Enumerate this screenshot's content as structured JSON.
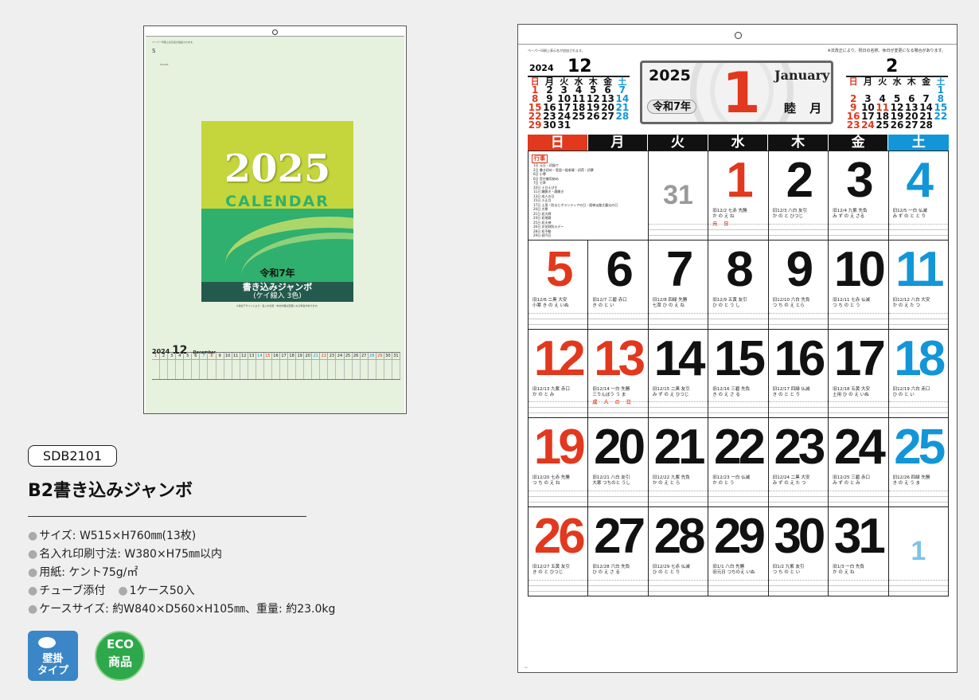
{
  "cover": {
    "top_note": "ペーパー印刷上表示名が追加されます。",
    "logo": "S",
    "small_code": "SA-001",
    "year": "2025",
    "word": "CALENDAR",
    "era": "令和7年",
    "band_title": "書き込みジャンボ",
    "band_sub": "(ケイ線入 3色)",
    "note": "※当社デザインにより、名入れ位置・本文内容は変更になる場合があります。",
    "strip_year": "2024",
    "strip_month": "12",
    "strip_en": "December",
    "strip_days": [
      "1",
      "2",
      "3",
      "4",
      "5",
      "6",
      "7",
      "8",
      "9",
      "10",
      "11",
      "12",
      "13",
      "14",
      "15",
      "16",
      "17",
      "18",
      "19",
      "20",
      "21",
      "22",
      "23",
      "24",
      "25",
      "26",
      "27",
      "28",
      "29",
      "30",
      "31"
    ]
  },
  "spec": {
    "code": "SDB2101",
    "title": "B2書き込みジャンボ",
    "rows": [
      "サイズ: W515×H760㎜(13枚)",
      "名入れ印刷寸法: W380×H75㎜以内",
      "用紙: ケント75g/㎡"
    ],
    "row4_a": "チューブ添付",
    "row4_b": "1ケース50入",
    "row5": "ケースサイズ: 約W840×D560×H105㎜、重量: 約23.0kg",
    "bullet": "●"
  },
  "badges": {
    "wall": "壁掛タイプ",
    "wall_l1": "壁掛",
    "wall_l2": "タイプ",
    "eco_l1": "ECO",
    "eco_l2": "商品"
  },
  "sheet": {
    "note_left": "ペーパー印刷上表示名が追加されます。",
    "note_right": "※法改正により、祝日の名称、休日が変更になる場合があります。",
    "footer": "ee",
    "prev_year": "2024",
    "prev_month": "12",
    "next_month": "2",
    "header": {
      "year": "2025",
      "month": "1",
      "english": "January",
      "era": "令和7年",
      "traditional": "睦 月"
    },
    "weekdays": [
      "日",
      "月",
      "火",
      "水",
      "木",
      "金",
      "土"
    ],
    "mini_prev": [
      "日",
      "月",
      "火",
      "水",
      "木",
      "金",
      "土",
      "1",
      "2",
      "3",
      "4",
      "5",
      "6",
      "7",
      "8",
      "9",
      "10",
      "11",
      "12",
      "13",
      "14",
      "15",
      "16",
      "17",
      "18",
      "19",
      "20",
      "21",
      "22",
      "23",
      "24",
      "25",
      "26",
      "27",
      "28",
      "29",
      "30",
      "31",
      "",
      "",
      "",
      ""
    ],
    "mini_next": [
      "日",
      "月",
      "火",
      "水",
      "木",
      "金",
      "土",
      "",
      "",
      "",
      "",
      "",
      "",
      "1",
      "2",
      "3",
      "4",
      "5",
      "6",
      "7",
      "8",
      "9",
      "10",
      "11",
      "12",
      "13",
      "14",
      "15",
      "16",
      "17",
      "18",
      "19",
      "20",
      "21",
      "22",
      "23",
      "24",
      "25",
      "26",
      "27",
      "28",
      "",
      ""
    ],
    "events_title": "行事",
    "events": [
      "1日 元旦・初詣で",
      "2日 書き初め・皇居一般参賀・初荷・初夢",
      "6日 小寒",
      "6日 官庁御用始め",
      "7日 七草",
      "10日 十日えびす",
      "11日 鏡開き・蔵開き",
      "13日 成人の日",
      "15日 小正月",
      "17日 土用・防災とボランティアの日・阪神淡路大震災の日",
      "20日 大寒",
      "21日 初大師",
      "24日 初地蔵",
      "25日 初天神",
      "26日 文化財防火デー",
      "28日 初不動",
      "29日 初円日"
    ],
    "cells": [
      {
        "n": "",
        "c": "",
        "i1": "",
        "i2": "",
        "h": ""
      },
      {
        "n": "",
        "c": "",
        "i1": "",
        "i2": "",
        "h": ""
      },
      {
        "n": "31",
        "c": "g",
        "i1": "",
        "i2": "",
        "h": ""
      },
      {
        "n": "1",
        "c": "r",
        "i1": "旧12/2 七赤 先勝",
        "i2": "か の え ね",
        "h": "元 日"
      },
      {
        "n": "2",
        "c": "",
        "i1": "旧12/3 八白 友引",
        "i2": "か の と ひつじ",
        "h": ""
      },
      {
        "n": "3",
        "c": "",
        "i1": "旧12/4 九紫 先負",
        "i2": "み ず の え さる",
        "h": ""
      },
      {
        "n": "4",
        "c": "b",
        "i1": "旧12/5 一白 仏滅",
        "i2": "み ず の と と り",
        "h": ""
      },
      {
        "n": "5",
        "c": "r",
        "i1": "旧12/6 二黒 大安",
        "i2": "小寒 き の え いぬ",
        "h": ""
      },
      {
        "n": "6",
        "c": "",
        "i1": "旧12/7 三碧 赤口",
        "i2": "き の と い",
        "h": ""
      },
      {
        "n": "7",
        "c": "",
        "i1": "旧12/8 四緑 先勝",
        "i2": "七草 ひ の え ね",
        "h": ""
      },
      {
        "n": "8",
        "c": "",
        "i1": "旧12/9 五黄 友引",
        "i2": "ひ の と う し",
        "h": ""
      },
      {
        "n": "9",
        "c": "",
        "i1": "旧12/10 六白 先負",
        "i2": "つ ち の え とら",
        "h": ""
      },
      {
        "n": "10",
        "c": "",
        "i1": "旧12/11 七赤 仏滅",
        "i2": "つ ち の と う",
        "h": ""
      },
      {
        "n": "11",
        "c": "b",
        "i1": "旧12/12 八白 大安",
        "i2": "か の え た つ",
        "h": ""
      },
      {
        "n": "12",
        "c": "r",
        "i1": "旧12/13 九紫 赤口",
        "i2": "か の と み",
        "h": ""
      },
      {
        "n": "13",
        "c": "r",
        "i1": "旧12/14 一白 先勝",
        "i2": "三りんぼう う ま",
        "h": "成 人 の 日"
      },
      {
        "n": "14",
        "c": "",
        "i1": "旧12/15 二黒 友引",
        "i2": "み ず の え ひつじ",
        "h": ""
      },
      {
        "n": "15",
        "c": "",
        "i1": "旧12/16 三碧 先負",
        "i2": "き の え さ る",
        "h": ""
      },
      {
        "n": "16",
        "c": "",
        "i1": "旧12/17 四緑 仏滅",
        "i2": "き の と と り",
        "h": ""
      },
      {
        "n": "17",
        "c": "",
        "i1": "旧12/18 五黄 大安",
        "i2": "土用 ひ の え いぬ",
        "h": ""
      },
      {
        "n": "18",
        "c": "b",
        "i1": "旧12/19 六白 赤口",
        "i2": "ひ の と い",
        "h": ""
      },
      {
        "n": "19",
        "c": "r",
        "i1": "旧12/20 七赤 先勝",
        "i2": "つ ち の え ね",
        "h": ""
      },
      {
        "n": "20",
        "c": "",
        "i1": "旧12/21 八白 友引",
        "i2": "大寒 つちのと うし",
        "h": ""
      },
      {
        "n": "21",
        "c": "",
        "i1": "旧12/22 九紫 先負",
        "i2": "か の え と ら",
        "h": ""
      },
      {
        "n": "22",
        "c": "",
        "i1": "旧12/23 一白 仏滅",
        "i2": "か の と う",
        "h": ""
      },
      {
        "n": "23",
        "c": "",
        "i1": "旧12/24 二黒 大安",
        "i2": "み ず の え た つ",
        "h": ""
      },
      {
        "n": "24",
        "c": "",
        "i1": "旧12/25 三碧 赤口",
        "i2": "み ず の と み",
        "h": ""
      },
      {
        "n": "25",
        "c": "b",
        "i1": "旧12/26 四緑 先勝",
        "i2": "き の え う ま",
        "h": ""
      },
      {
        "n": "26",
        "c": "r",
        "i1": "旧12/27 五黄 友引",
        "i2": "き の と ひつじ",
        "h": ""
      },
      {
        "n": "27",
        "c": "",
        "i1": "旧12/28 六白 先負",
        "i2": "ひ の え さ る",
        "h": ""
      },
      {
        "n": "28",
        "c": "",
        "i1": "旧12/29 七赤 仏滅",
        "i2": "ひ の と と り",
        "h": ""
      },
      {
        "n": "29",
        "c": "",
        "i1": "旧1/1 八白 先勝",
        "i2": "旧元日 つちのえ いぬ",
        "h": ""
      },
      {
        "n": "30",
        "c": "",
        "i1": "旧1/2 九紫 友引",
        "i2": "つ ち の と い",
        "h": ""
      },
      {
        "n": "31",
        "c": "",
        "i1": "旧1/3 一白 先負",
        "i2": "か の え ね",
        "h": ""
      },
      {
        "n": "1",
        "c": "lb",
        "i1": "",
        "i2": "",
        "h": ""
      }
    ]
  }
}
